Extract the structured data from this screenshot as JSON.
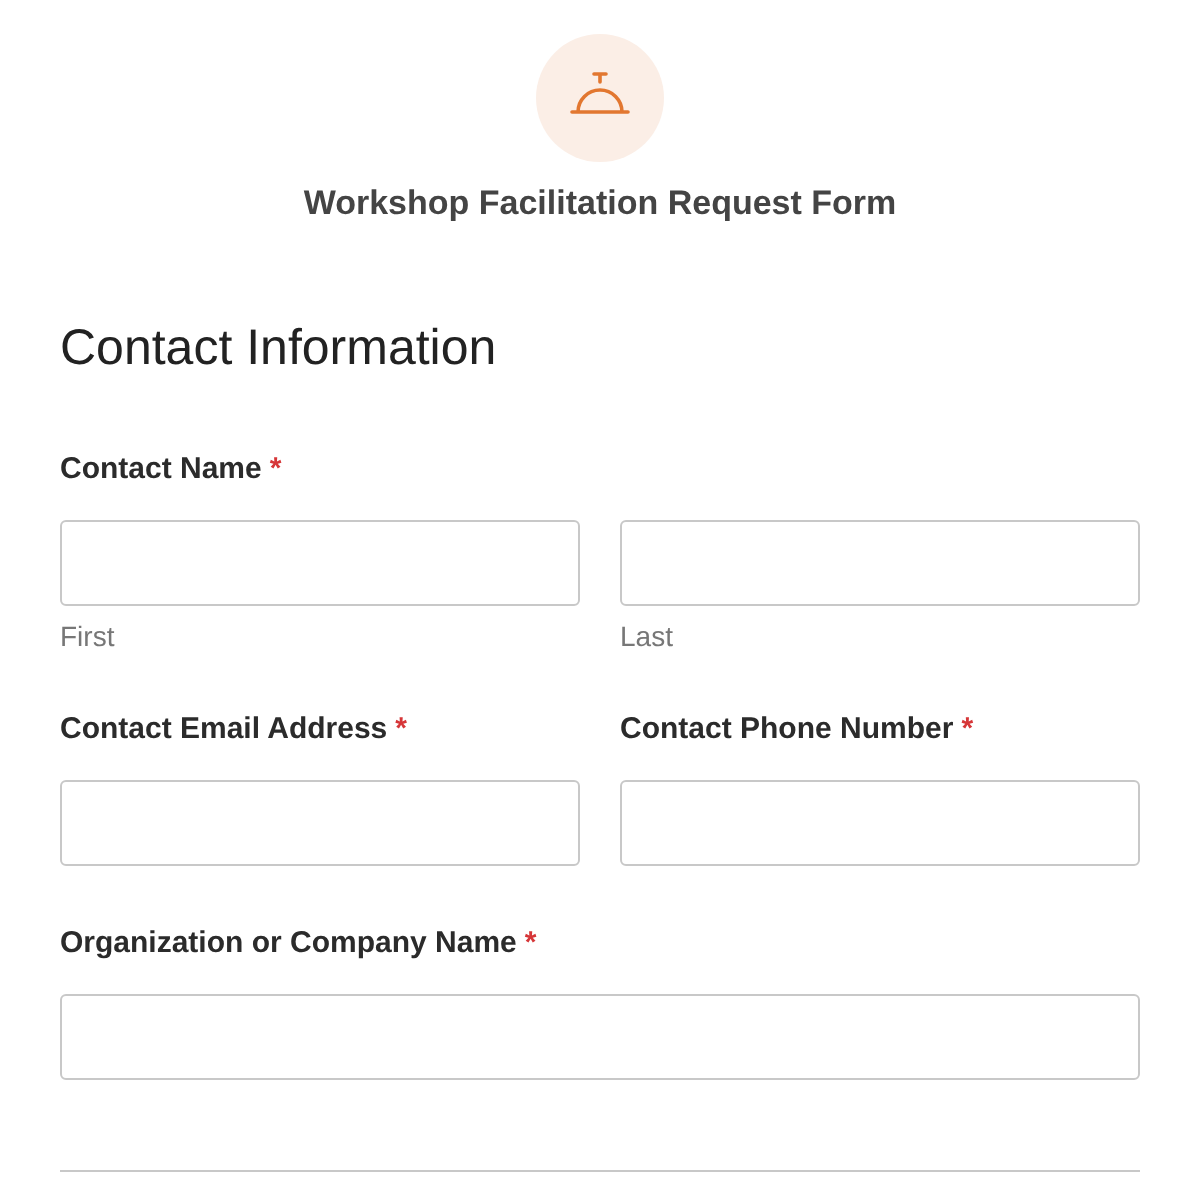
{
  "header": {
    "title": "Workshop Facilitation Request Form"
  },
  "section": {
    "title": "Contact Information"
  },
  "fields": [
    {
      "kind": "name",
      "label": "Contact Name",
      "required_mark": "*",
      "parts": [
        {
          "sublabel": "First"
        },
        {
          "sublabel": "Last"
        }
      ]
    },
    {
      "kind": "pair",
      "items": [
        {
          "label": "Contact Email Address",
          "required_mark": "*"
        },
        {
          "label": "Contact Phone Number",
          "required_mark": "*"
        }
      ]
    },
    {
      "kind": "single",
      "label": "Organization or Company Name",
      "required_mark": "*"
    }
  ]
}
